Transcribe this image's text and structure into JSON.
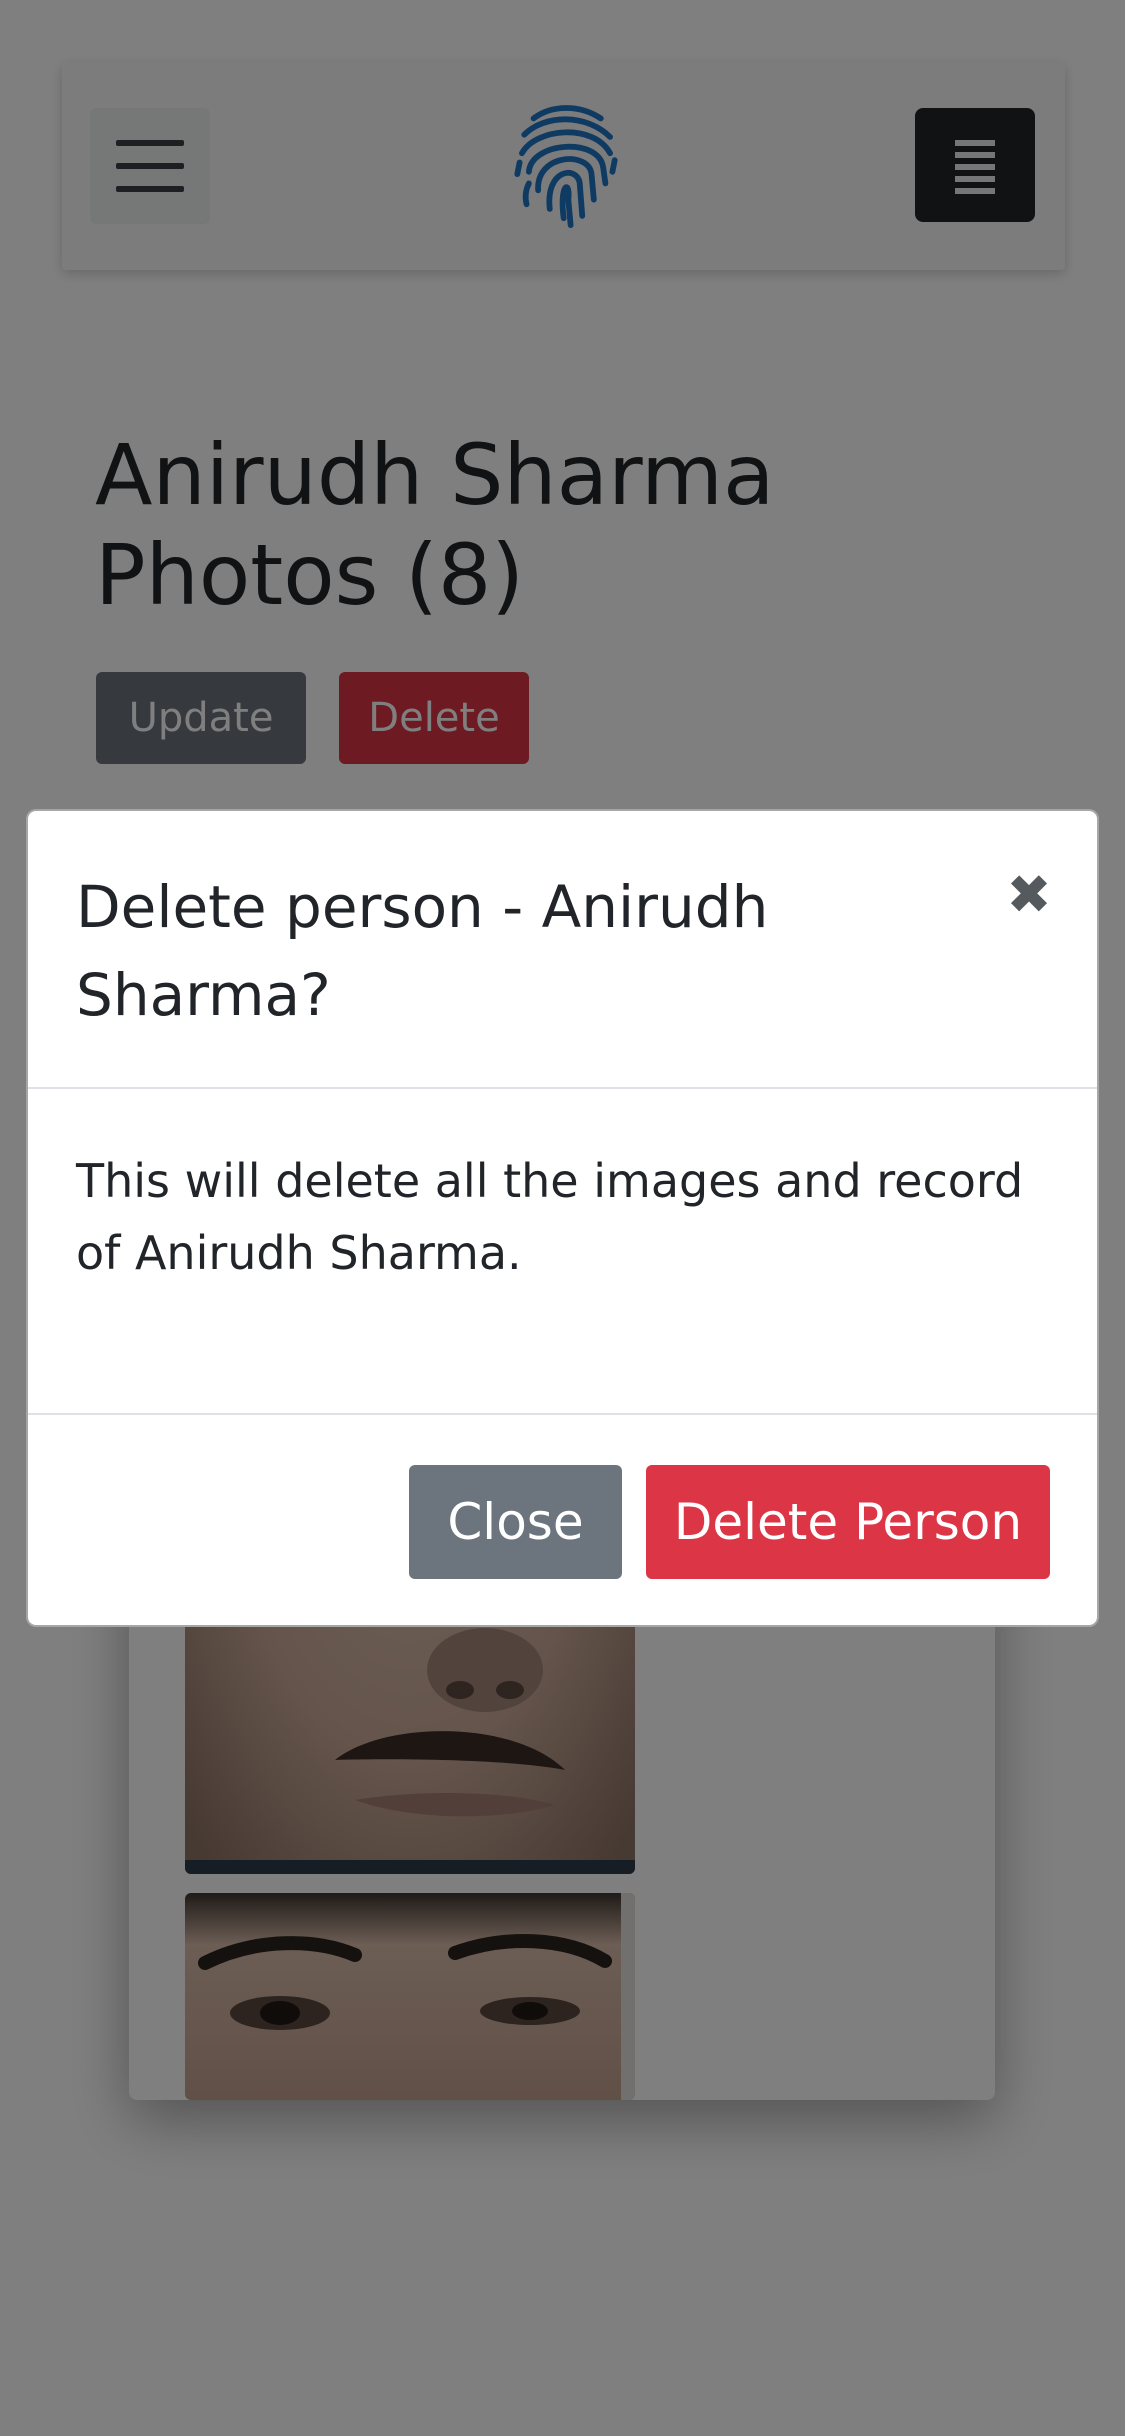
{
  "header": {
    "menu_toggle": "hamburger-icon",
    "logo": "fingerprint-icon",
    "menu_button": "list-icon"
  },
  "page": {
    "title_line1": "Anirudh Sharma",
    "title_line2": "Photos (8)",
    "update_label": "Update",
    "delete_label": "Delete"
  },
  "modal": {
    "title": "Delete person - Anirudh Sharma?",
    "close_icon": "close-icon",
    "body_text": "This will delete all the images and record of Anirudh Sharma.",
    "close_label": "Close",
    "delete_person_label": "Delete Person"
  },
  "colors": {
    "secondary": "#6c757d",
    "danger": "#dc3545",
    "dark": "#212529",
    "logo_blue": "#1f76c7"
  }
}
